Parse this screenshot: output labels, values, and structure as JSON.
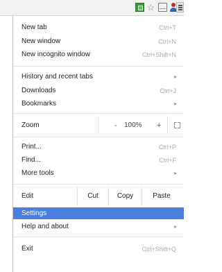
{
  "toolbar": {
    "icons": [
      "extension-icon",
      "star-icon",
      "cast-icon",
      "profile-icon",
      "chrome-menu-icon"
    ]
  },
  "menu": {
    "new_tab": {
      "label": "New tab",
      "shortcut": "Ctrl+T"
    },
    "new_window": {
      "label": "New window",
      "shortcut": "Ctrl+N"
    },
    "new_incognito": {
      "label": "New incognito window",
      "shortcut": "Ctrl+Shift+N"
    },
    "history": {
      "label": "History and recent tabs"
    },
    "downloads": {
      "label": "Downloads",
      "shortcut": "Ctrl+J"
    },
    "bookmarks": {
      "label": "Bookmarks"
    },
    "zoom": {
      "label": "Zoom",
      "minus": "-",
      "value": "100%",
      "plus": "+"
    },
    "print": {
      "label": "Print...",
      "shortcut": "Ctrl+P"
    },
    "find": {
      "label": "Find...",
      "shortcut": "Ctrl+F"
    },
    "more_tools": {
      "label": "More tools"
    },
    "edit": {
      "label": "Edit",
      "cut": "Cut",
      "copy": "Copy",
      "paste": "Paste"
    },
    "settings": {
      "label": "Settings"
    },
    "help": {
      "label": "Help and about"
    },
    "exit": {
      "label": "Exit",
      "shortcut": "Ctrl+Shift+Q"
    }
  },
  "colors": {
    "highlight": "#4a7fe0",
    "shortcut_text": "#a9a9a9"
  }
}
